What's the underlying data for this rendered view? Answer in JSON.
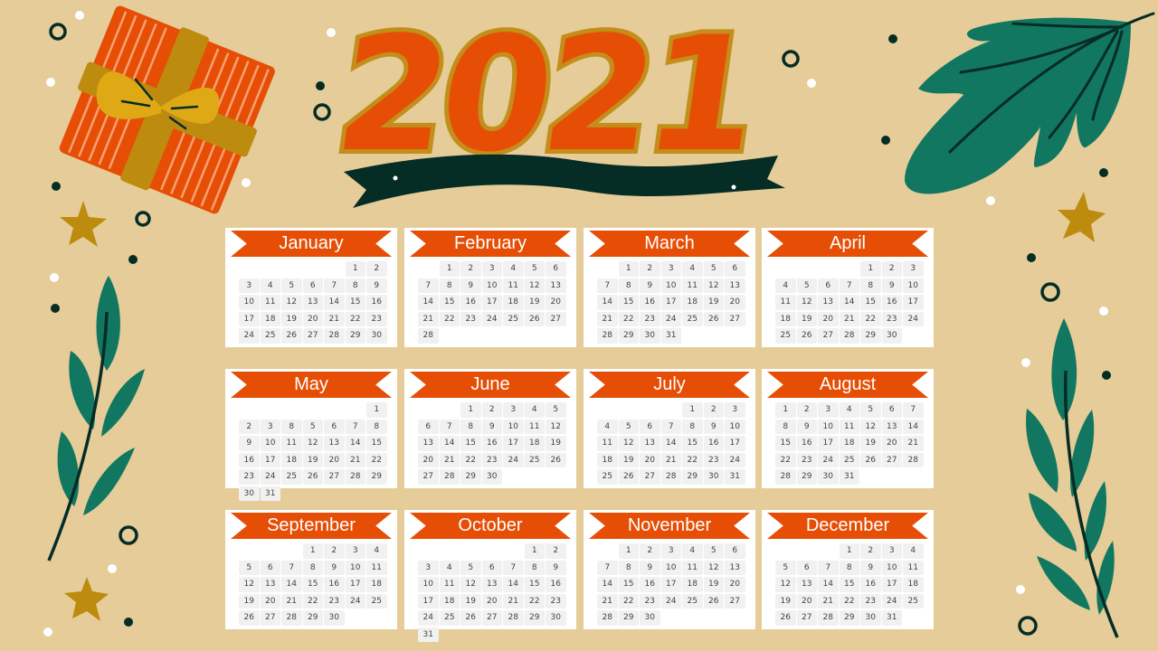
{
  "title": {
    "year": "2021"
  },
  "colors": {
    "background": "#e5cc98",
    "banner": "#e64e06",
    "leaf": "#117760",
    "dark": "#052c25",
    "gold": "#bd8b0d",
    "bow": "#dfa915"
  },
  "months": [
    {
      "name": "January",
      "offset": 5,
      "days": [
        "1",
        "2",
        "3",
        "4",
        "5",
        "6",
        "7",
        "8",
        "9",
        "10",
        "11",
        "12",
        "13",
        "14",
        "15",
        "16",
        "17",
        "18",
        "19",
        "20",
        "21",
        "22",
        "23",
        "24",
        "25",
        "26",
        "27",
        "28",
        "29",
        "30"
      ]
    },
    {
      "name": "February",
      "offset": 1,
      "days": [
        "1",
        "2",
        "3",
        "4",
        "5",
        "6",
        "7",
        "8",
        "9",
        "10",
        "11",
        "12",
        "13",
        "14",
        "15",
        "16",
        "17",
        "18",
        "19",
        "20",
        "21",
        "22",
        "23",
        "24",
        "25",
        "26",
        "27",
        "28"
      ]
    },
    {
      "name": "March",
      "offset": 1,
      "days": [
        "1",
        "2",
        "3",
        "4",
        "5",
        "6",
        "7",
        "8",
        "9",
        "10",
        "11",
        "12",
        "13",
        "14",
        "15",
        "16",
        "17",
        "18",
        "19",
        "20",
        "21",
        "22",
        "23",
        "24",
        "25",
        "26",
        "27",
        "28",
        "29",
        "30",
        "31"
      ]
    },
    {
      "name": "April",
      "offset": 4,
      "days": [
        "1",
        "2",
        "3",
        "4",
        "5",
        "6",
        "7",
        "8",
        "9",
        "10",
        "11",
        "12",
        "13",
        "14",
        "15",
        "16",
        "17",
        "18",
        "19",
        "20",
        "21",
        "22",
        "23",
        "24",
        "25",
        "26",
        "27",
        "28",
        "29",
        "30"
      ]
    },
    {
      "name": "May",
      "offset": 6,
      "days": [
        "1",
        "2",
        "3",
        "8",
        "5",
        "6",
        "7",
        "8",
        "9",
        "10",
        "11",
        "12",
        "13",
        "14",
        "15",
        "16",
        "17",
        "18",
        "19",
        "20",
        "21",
        "22",
        "23",
        "24",
        "25",
        "26",
        "27",
        "28",
        "29",
        "30",
        "31"
      ]
    },
    {
      "name": "June",
      "offset": 2,
      "days": [
        "1",
        "2",
        "3",
        "4",
        "5",
        "6",
        "7",
        "8",
        "9",
        "10",
        "11",
        "12",
        "13",
        "14",
        "15",
        "16",
        "17",
        "18",
        "19",
        "20",
        "21",
        "22",
        "23",
        "24",
        "25",
        "26",
        "27",
        "28",
        "29",
        "30"
      ]
    },
    {
      "name": "July",
      "offset": 4,
      "days": [
        "1",
        "2",
        "3",
        "4",
        "5",
        "6",
        "7",
        "8",
        "9",
        "10",
        "11",
        "12",
        "13",
        "14",
        "15",
        "16",
        "17",
        "18",
        "19",
        "20",
        "21",
        "22",
        "23",
        "24",
        "25",
        "26",
        "27",
        "28",
        "29",
        "30",
        "31"
      ]
    },
    {
      "name": "August",
      "offset": 0,
      "days": [
        "1",
        "2",
        "3",
        "4",
        "5",
        "6",
        "7",
        "8",
        "9",
        "10",
        "11",
        "12",
        "13",
        "14",
        "15",
        "16",
        "17",
        "18",
        "19",
        "20",
        "21",
        "22",
        "23",
        "24",
        "25",
        "26",
        "27",
        "28",
        "28",
        "29",
        "30",
        "31"
      ]
    },
    {
      "name": "September",
      "offset": 3,
      "days": [
        "1",
        "2",
        "3",
        "4",
        "5",
        "6",
        "7",
        "8",
        "9",
        "10",
        "11",
        "12",
        "13",
        "14",
        "15",
        "16",
        "17",
        "18",
        "19",
        "20",
        "21",
        "22",
        "23",
        "24",
        "25",
        "26",
        "27",
        "28",
        "29",
        "30"
      ]
    },
    {
      "name": "October",
      "offset": 5,
      "days": [
        "1",
        "2",
        "3",
        "4",
        "5",
        "6",
        "7",
        "8",
        "9",
        "10",
        "11",
        "12",
        "13",
        "14",
        "15",
        "16",
        "17",
        "18",
        "19",
        "20",
        "21",
        "22",
        "23",
        "24",
        "25",
        "26",
        "27",
        "28",
        "29",
        "30",
        "31"
      ]
    },
    {
      "name": "November",
      "offset": 1,
      "days": [
        "1",
        "2",
        "3",
        "4",
        "5",
        "6",
        "7",
        "8",
        "9",
        "10",
        "11",
        "12",
        "13",
        "14",
        "15",
        "16",
        "17",
        "18",
        "19",
        "20",
        "21",
        "22",
        "23",
        "24",
        "25",
        "26",
        "27",
        "28",
        "29",
        "30"
      ]
    },
    {
      "name": "December",
      "offset": 3,
      "days": [
        "1",
        "2",
        "3",
        "4",
        "5",
        "6",
        "7",
        "8",
        "9",
        "10",
        "11",
        "12",
        "13",
        "14",
        "15",
        "16",
        "17",
        "18",
        "19",
        "20",
        "21",
        "22",
        "23",
        "24",
        "25",
        "26",
        "27",
        "28",
        "29",
        "30",
        "31"
      ]
    }
  ],
  "decorations": [
    "gift-box",
    "bow",
    "star",
    "leaf",
    "leaf-branch",
    "ribbon-banner",
    "confetti-dots",
    "rings"
  ]
}
